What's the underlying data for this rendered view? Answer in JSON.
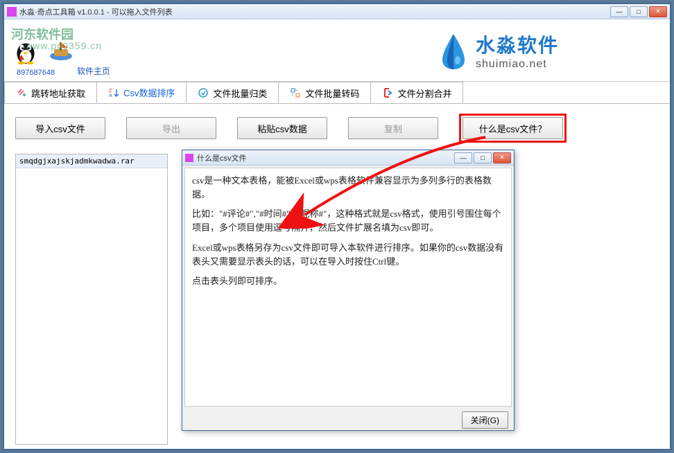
{
  "window": {
    "title": "水淼·奇点工具箱 v1.0.0.1 - 可以拖入文件列表",
    "minimize": "—",
    "maximize": "□",
    "close": "✕"
  },
  "header": {
    "watermark_text": "河东软件园",
    "watermark_url": "www.pc0359.cn",
    "qq_number": "897687648",
    "software_home": "软件主页",
    "brand_cn": "水淼软件",
    "brand_en": "shuimiao.net"
  },
  "tabs": [
    {
      "label": "跳转地址获取",
      "icon": "link"
    },
    {
      "label": "Csv数据排序",
      "icon": "sort",
      "active": true
    },
    {
      "label": "文件批量归类",
      "icon": "folder"
    },
    {
      "label": "文件批量转码",
      "icon": "encode"
    },
    {
      "label": "文件分割合并",
      "icon": "split"
    }
  ],
  "toolbar": {
    "import_csv": "导入csv文件",
    "export": "导出",
    "paste_csv": "粘贴csv数据",
    "copy": "复制",
    "what_is_csv": "什么是csv文件？"
  },
  "file_list": {
    "items": [
      "smqdgjxajskjadmkwadwa.rar"
    ]
  },
  "dialog": {
    "title": "什么是csv文件",
    "paragraphs": [
      "csv是一种文本表格，能被Excel或wps表格软件兼容显示为多列多行的表格数据。",
      "比如：\"#评论#\",\"#时间#\",\"#昵称#\"，这种格式就是csv格式，使用引号围住每个项目，多个项目使用逗号隔开，然后文件扩展名填为csv即可。",
      "Excel或wps表格另存为csv文件即可导入本软件进行排序。如果你的csv数据没有表头又需要显示表头的话，可以在导入时按住Ctrl键。",
      "点击表头列即可排序。"
    ],
    "close_button": "关闭(G)"
  }
}
